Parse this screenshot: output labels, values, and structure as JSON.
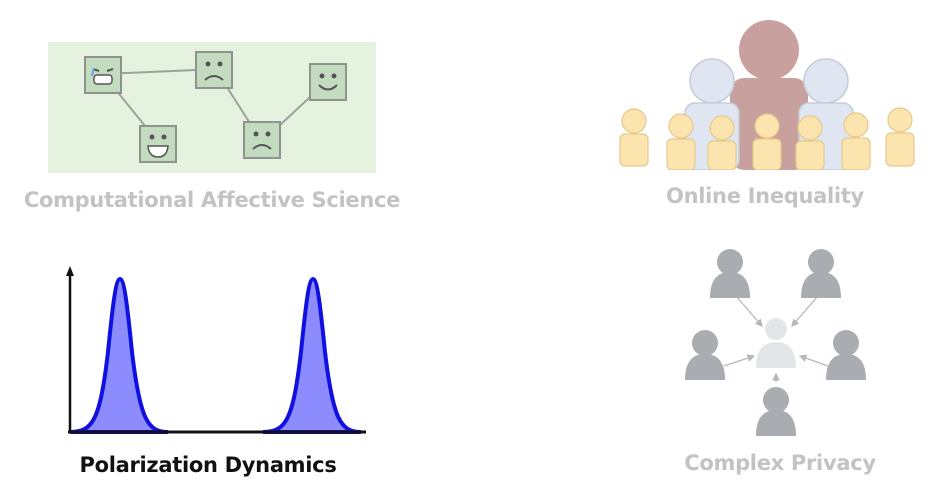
{
  "panels": {
    "affective": {
      "caption": "Computational Affective Science",
      "state": "inactive"
    },
    "inequality": {
      "caption": "Online Inequality",
      "state": "inactive"
    },
    "polarization": {
      "caption": "Polarization Dynamics",
      "state": "active"
    },
    "privacy": {
      "caption": "Complex Privacy",
      "state": "inactive"
    }
  },
  "colors": {
    "inactive_text": "#c3c3c3",
    "active_text": "#111111",
    "affective_bg": "#e6f2e0",
    "face_fill": "#c3dcc0",
    "person_gray": "#a9acb0",
    "crowd_red": "#c8a19e",
    "crowd_blue": "#dfe6f2",
    "crowd_yellow": "#fbe4ae",
    "curve_fill": "#8c8cff",
    "curve_stroke": "#1010e0"
  },
  "icons": {
    "faces": [
      "crying-face-icon",
      "sad-face-icon",
      "smiley-face-icon",
      "laughing-face-icon",
      "frown-face-icon"
    ],
    "people": [
      "person-icon"
    ]
  }
}
